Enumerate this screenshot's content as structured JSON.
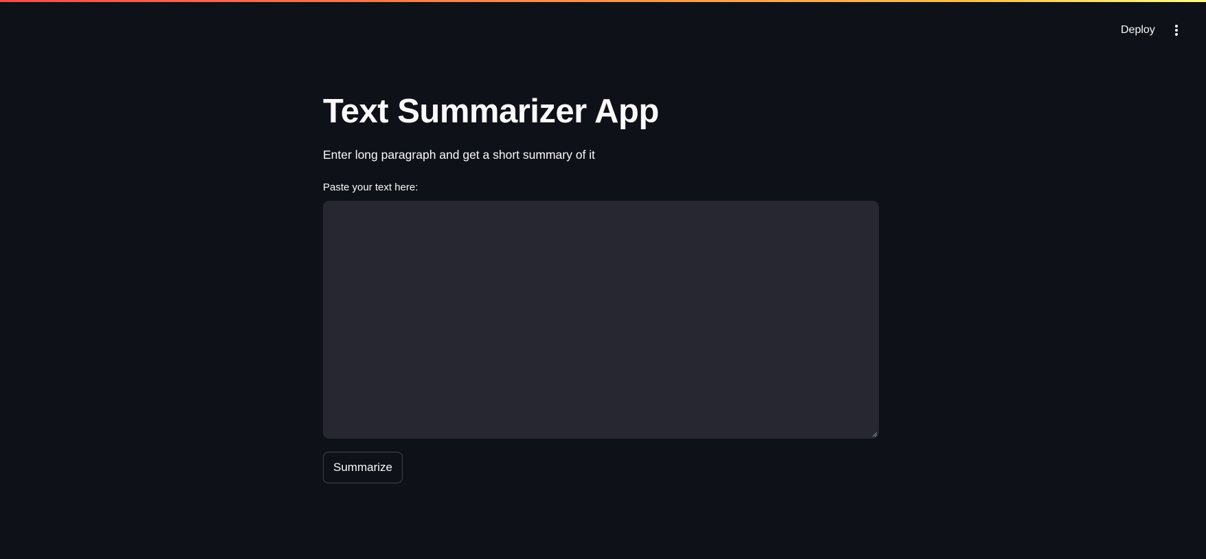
{
  "header": {
    "deploy_label": "Deploy",
    "menu_icon": "vertical-ellipsis-icon"
  },
  "main": {
    "title": "Text Summarizer App",
    "subtitle": "Enter long paragraph and get a short summary of it",
    "input_label": "Paste your text here:",
    "input_value": "",
    "button_label": "Summarize"
  },
  "colors": {
    "background": "#0e1117",
    "input_background": "#262730",
    "text": "#fafafa",
    "accent_gradient_start": "#ff4b4b",
    "accent_gradient_end": "#fffd80"
  }
}
